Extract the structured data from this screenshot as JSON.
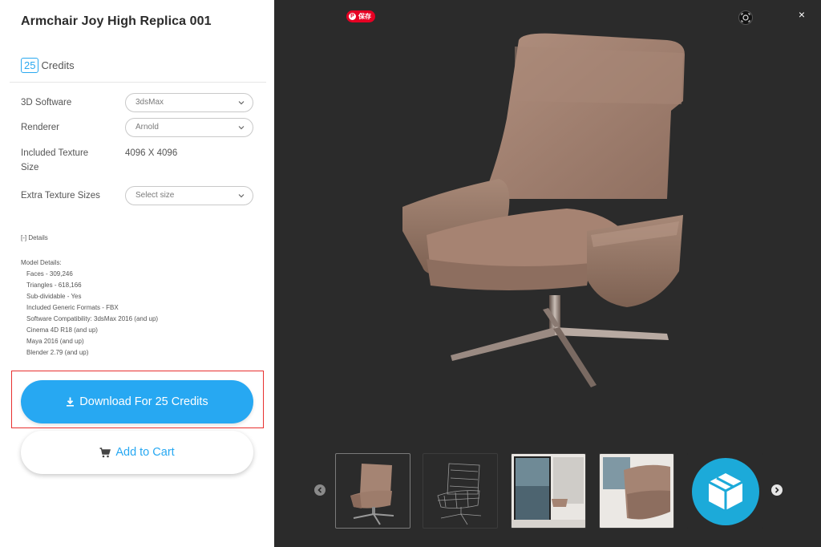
{
  "product": {
    "title": "Armchair Joy High Replica 001",
    "credits_value": "25",
    "credits_label": "Credits"
  },
  "options": {
    "software_label": "3D Software",
    "software_value": "3dsMax",
    "renderer_label": "Renderer",
    "renderer_value": "Arnold",
    "texture_size_label_line1": "Included Texture",
    "texture_size_label_line2": "Size",
    "texture_size_value": "4096 X 4096",
    "extra_sizes_label": "Extra Texture Sizes",
    "extra_sizes_placeholder": "Select size"
  },
  "details": {
    "toggle": "[-] Details",
    "heading": "Model Details:",
    "lines": [
      "Faces - 309,246",
      "Triangles - 618,166",
      "Sub-dividable - Yes",
      "Included Generic Formats - FBX",
      "Software Compatibility: 3dsMax 2016 (and up)",
      "Cinema 4D R18 (and up)",
      "Maya 2016 (and up)",
      "Blender 2.79 (and up)"
    ]
  },
  "actions": {
    "download_label": "Download For 25 Credits",
    "cart_label": "Add to Cart"
  },
  "viewer": {
    "pin_label": "保存",
    "close_symbol": "×",
    "thumbnails": [
      "chair-render",
      "chair-wireframe",
      "room-scene",
      "closeup-scene",
      "sketchfab-3d-view"
    ]
  },
  "colors": {
    "accent": "#27a8f2",
    "highlight": "#e8302f",
    "viewer_bg": "#2b2b2b",
    "pinterest": "#e60023"
  }
}
